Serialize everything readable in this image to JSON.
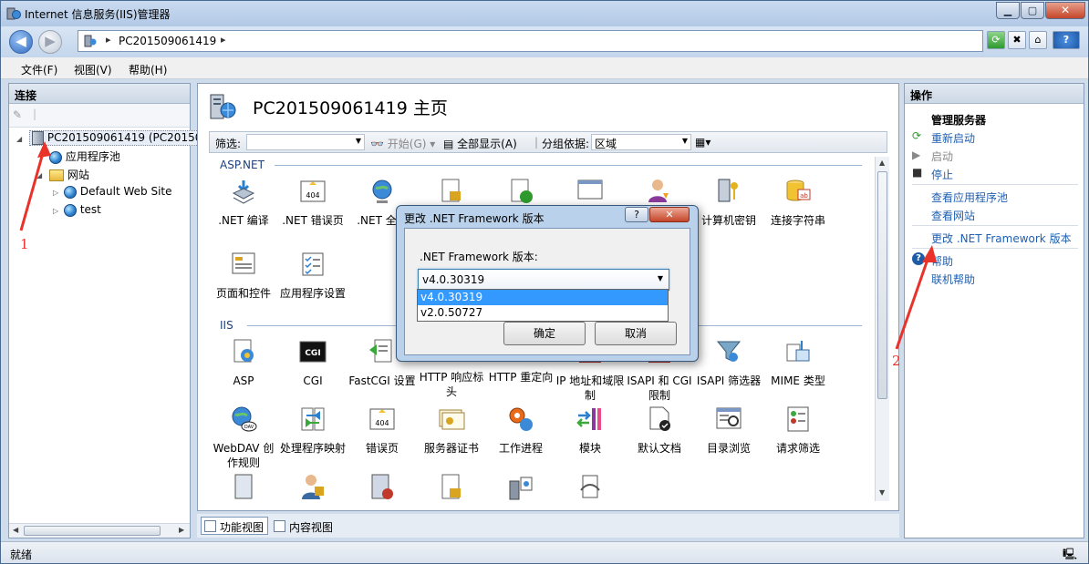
{
  "window": {
    "title": "Internet 信息服务(IIS)管理器",
    "buttons": {
      "minimize": "▁",
      "maximize": "▢",
      "close": "✕"
    }
  },
  "address": {
    "path": "PC201509061419",
    "separator": "▸"
  },
  "toolbar_right": {
    "help": "?"
  },
  "menu": [
    "文件(F)",
    "视图(V)",
    "帮助(H)"
  ],
  "connections": {
    "title": "连接",
    "server": "PC201509061419 (PC20150",
    "app_pools": "应用程序池",
    "sites": "网站",
    "site1": "Default Web Site",
    "site2": "test"
  },
  "center": {
    "title": "PC201509061419 主页",
    "filter_label": "筛选:",
    "start_label": "开始(G)",
    "show_all_label": "全部显示(A)",
    "group_label": "分组依据:",
    "group_value": "区域",
    "groups": {
      "aspnet": "ASP.NET",
      "iis": "IIS"
    },
    "aspnet_items": [
      ".NET 编译",
      ".NET 错误页",
      ".NET 全球",
      "",
      "",
      "",
      "",
      "计算机密钥",
      "连接字符串"
    ],
    "aspnet_row2": [
      "页面和控件",
      "应用程序设置"
    ],
    "iis_items": [
      "ASP",
      "CGI",
      "FastCGI 设置",
      "HTTP 响应标头",
      "HTTP 重定向",
      "IP 地址和域限制",
      "ISAPI 和 CGI 限制",
      "ISAPI 筛选器",
      "MIME 类型"
    ],
    "iis_row2": [
      "WebDAV 创作规则",
      "处理程序映射",
      "错误页",
      "服务器证书",
      "工作进程",
      "模块",
      "默认文档",
      "目录浏览",
      "请求筛选"
    ]
  },
  "viewtabs": {
    "features": "功能视图",
    "content": "内容视图"
  },
  "actions": {
    "title": "操作",
    "manage_server": "管理服务器",
    "restart": "重新启动",
    "start": "启动",
    "stop": "停止",
    "view_pools": "查看应用程序池",
    "view_sites": "查看网站",
    "change_fw": "更改 .NET Framework 版本",
    "help": "帮助",
    "online_help": "联机帮助"
  },
  "status": {
    "text": "就绪"
  },
  "dialog": {
    "title": "更改 .NET Framework 版本",
    "help_btn": "?",
    "close_btn": "✕",
    "label": ".NET Framework 版本:",
    "selected": "v4.0.30319",
    "options": [
      "v4.0.30319",
      "v2.0.50727"
    ],
    "ok": "确定",
    "cancel": "取消"
  },
  "annotations": {
    "one": "1",
    "two": "2"
  }
}
